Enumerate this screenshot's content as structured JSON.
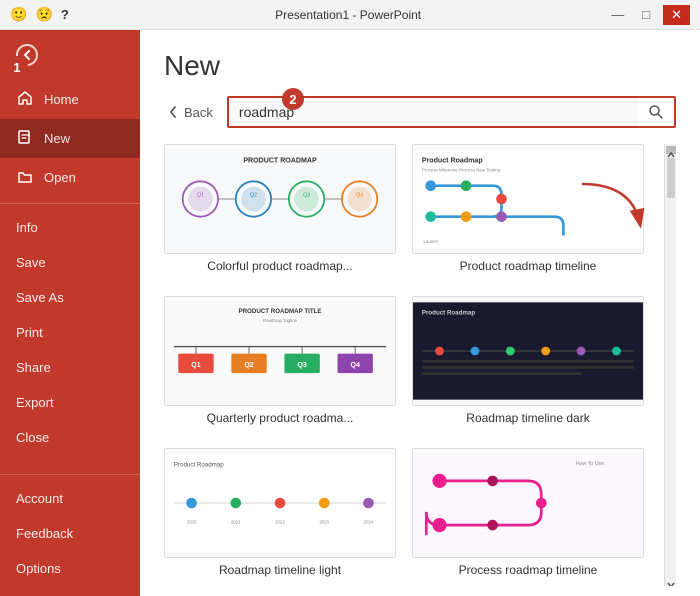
{
  "titleBar": {
    "title": "Presentation1 - PowerPoint",
    "icons": [
      "😊",
      "😟",
      "?",
      "—",
      "□",
      "✕"
    ]
  },
  "sidebar": {
    "backLabel": "←",
    "items": [
      {
        "id": "home",
        "label": "Home",
        "icon": "🏠"
      },
      {
        "id": "new",
        "label": "New",
        "icon": "📄",
        "active": true
      },
      {
        "id": "open",
        "label": "Open",
        "icon": "📂"
      },
      {
        "id": "info",
        "label": "Info",
        "icon": ""
      },
      {
        "id": "save",
        "label": "Save",
        "icon": ""
      },
      {
        "id": "save-as",
        "label": "Save As",
        "icon": ""
      },
      {
        "id": "print",
        "label": "Print",
        "icon": ""
      },
      {
        "id": "share",
        "label": "Share",
        "icon": ""
      },
      {
        "id": "export",
        "label": "Export",
        "icon": ""
      },
      {
        "id": "close",
        "label": "Close",
        "icon": ""
      }
    ],
    "bottomItems": [
      {
        "id": "account",
        "label": "Account",
        "icon": ""
      },
      {
        "id": "feedback",
        "label": "Feedback",
        "icon": ""
      },
      {
        "id": "options",
        "label": "Options",
        "icon": ""
      }
    ]
  },
  "content": {
    "title": "New",
    "backButton": "Back",
    "searchPlaceholder": "roadmap",
    "searchValue": "roadmap",
    "annotations": {
      "badge1": "1",
      "badge2": "2"
    },
    "templates": [
      {
        "id": "colorful-roadmap",
        "label": "Colorful product roadmap...",
        "type": "colorful-circles",
        "headerText": "PRODUCT ROADMAP"
      },
      {
        "id": "product-timeline",
        "label": "Product roadmap timeline",
        "type": "timeline-snake",
        "headerText": "Product Roadmap"
      },
      {
        "id": "quarterly-roadmap",
        "label": "Quarterly product roadma...",
        "type": "quarterly-tree",
        "headerText": "PRODUCT ROADMAP TITLE"
      },
      {
        "id": "roadmap-dark",
        "label": "Roadmap timeline dark",
        "type": "dark-timeline",
        "headerText": "Product Roadmap"
      },
      {
        "id": "roadmap-light",
        "label": "Roadmap timeline light",
        "type": "light-timeline",
        "headerText": "Product Roadmap"
      },
      {
        "id": "process-roadmap",
        "label": "Process roadmap timeline",
        "type": "process-snake",
        "headerText": "How To Use"
      }
    ]
  }
}
